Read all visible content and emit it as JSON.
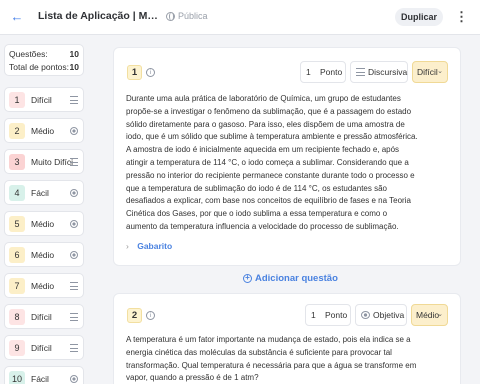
{
  "header": {
    "title": "Lista de Aplicação | Mudanças",
    "visibility": "Pública",
    "duplicate_label": "Duplicar"
  },
  "stats": {
    "questions_label": "Questões:",
    "questions_value": "10",
    "points_label": "Total de pontos:",
    "points_value": "10"
  },
  "nav": [
    {
      "num": "1",
      "label": "Difícil",
      "type": "lines-icon",
      "color": "#fde4e4"
    },
    {
      "num": "2",
      "label": "Médio",
      "type": "radio-icon",
      "color": "#fcefc8"
    },
    {
      "num": "3",
      "label": "Muito Difícil",
      "type": "lines-icon",
      "color": "#fbd3d3"
    },
    {
      "num": "4",
      "label": "Fácil",
      "type": "radio-icon",
      "color": "#d8f1ea"
    },
    {
      "num": "5",
      "label": "Médio",
      "type": "radio-icon",
      "color": "#fcefc8"
    },
    {
      "num": "6",
      "label": "Médio",
      "type": "radio-icon",
      "color": "#fcefc8"
    },
    {
      "num": "7",
      "label": "Médio",
      "type": "lines-icon",
      "color": "#fcefc8"
    },
    {
      "num": "8",
      "label": "Difícil",
      "type": "lines-icon",
      "color": "#fde4e4"
    },
    {
      "num": "9",
      "label": "Difícil",
      "type": "lines-icon",
      "color": "#fde4e4"
    },
    {
      "num": "10",
      "label": "Fácil",
      "type": "radio-icon",
      "color": "#d8f1ea"
    }
  ],
  "q1": {
    "num": "1",
    "points_value": "1",
    "points_label": "Ponto",
    "type": "Discursiva",
    "difficulty": "Difícil",
    "text": "Durante uma aula prática de laboratório de Química, um grupo de estudantes propõe-se a investigar o fenômeno da sublimação, que é a passagem do estado sólido diretamente para o gasoso. Para isso, eles dispõem de uma amostra de iodo, que é um sólido que sublime à temperatura ambiente e pressão atmosférica. A amostra de iodo é inicialmente aquecida em um recipiente fechado e, após atingir a temperatura de 114 °C, o iodo começa a sublimar. Considerando que a pressão no interior do recipiente permanece constante durante todo o processo e que a temperatura de sublimação do iodo é de 114 °C, os estudantes são desafiados a explicar, com base nos conceitos de equilíbrio de fases e na Teoria Cinética dos Gases, por que o iodo sublima a essa temperatura e como o aumento da temperatura influencia a velocidade do processo de sublimação.",
    "answer_label": "Gabarito"
  },
  "add_question_label": "Adicionar questão",
  "q2": {
    "num": "2",
    "points_value": "1",
    "points_label": "Ponto",
    "type": "Objetiva",
    "difficulty": "Médio",
    "text": "A temperatura é um fator importante na mudança de estado, pois ela indica se a energia cinética das moléculas da substância é suficiente para provocar tal transformação. Qual temperatura é necessária para que a água se transforme em vapor, quando a pressão é de 1 atm?"
  },
  "colors": {
    "accent": "#4a82e0",
    "medium": "#fcefc8",
    "hard": "#fde4e4",
    "easy": "#d8f1ea"
  }
}
